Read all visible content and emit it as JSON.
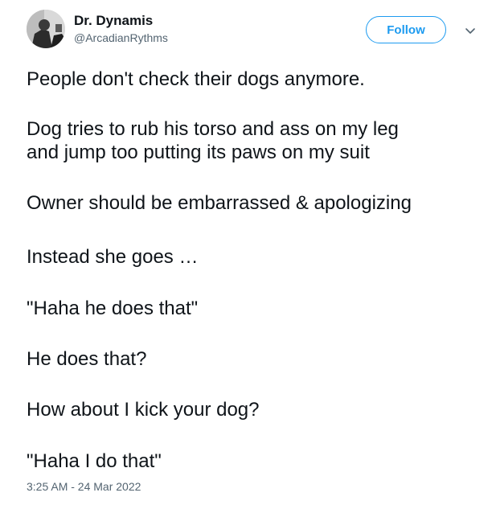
{
  "tweet": {
    "author": {
      "display_name": "Dr. Dynamis",
      "handle": "@ArcadianRythms"
    },
    "follow_label": "Follow",
    "paragraphs": [
      [
        "People don't check their dogs anymore."
      ],
      [
        "Dog tries to rub his torso and ass on my leg",
        "and jump too putting its paws on my suit"
      ],
      [
        "Owner should be embarrassed & apologizing"
      ],
      [
        "Instead she goes …"
      ],
      [
        "\"Haha he does that\""
      ],
      [
        "He does that?"
      ],
      [
        "How about I kick your dog?"
      ],
      [
        "\"Haha I do that\""
      ]
    ],
    "timestamp": "3:25 AM - 24 Mar 2022"
  },
  "colors": {
    "accent": "#1d9bf0",
    "text": "#0f1419",
    "secondary_text": "#536471",
    "background": "#ffffff"
  },
  "icons": {
    "more": "chevron-down-icon",
    "avatar": "profile-photo"
  }
}
